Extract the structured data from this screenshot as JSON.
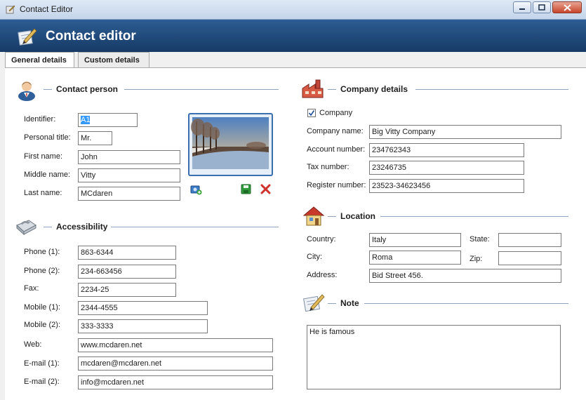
{
  "window": {
    "title": "Contact Editor"
  },
  "header": {
    "title": "Contact editor"
  },
  "tabs": [
    {
      "label": "General details"
    },
    {
      "label": "Custom details"
    }
  ],
  "contact_person": {
    "title": "Contact person",
    "identifier": {
      "label": "Identifier:",
      "value": "A1"
    },
    "personal_title": {
      "label": "Personal title:",
      "value": "Mr."
    },
    "first_name": {
      "label": "First name:",
      "value": "John"
    },
    "middle_name": {
      "label": "Middle name:",
      "value": "Vitty"
    },
    "last_name": {
      "label": "Last name:",
      "value": "MCdaren"
    }
  },
  "accessibility": {
    "title": "Accessibility",
    "phone1": {
      "label": "Phone (1):",
      "value": "863-6344"
    },
    "phone2": {
      "label": "Phone (2):",
      "value": "234-663456"
    },
    "fax": {
      "label": "Fax:",
      "value": "2234-25"
    },
    "mobile1": {
      "label": "Mobile (1):",
      "value": "2344-4555"
    },
    "mobile2": {
      "label": "Mobile (2):",
      "value": "333-3333"
    },
    "web": {
      "label": "Web:",
      "value": "www.mcdaren.net"
    },
    "email1": {
      "label": "E-mail (1):",
      "value": "mcdaren@mcdaren.net"
    },
    "email2": {
      "label": "E-mail (2):",
      "value": "info@mcdaren.net"
    }
  },
  "company_details": {
    "title": "Company details",
    "company_checkbox": {
      "label": "Company",
      "checked": true
    },
    "company_name": {
      "label": "Company name:",
      "value": "Big Vitty Company"
    },
    "account_number": {
      "label": "Account number:",
      "value": "234762343"
    },
    "tax_number": {
      "label": "Tax number:",
      "value": "23246735"
    },
    "register_number": {
      "label": "Register number:",
      "value": "23523-34623456"
    }
  },
  "location": {
    "title": "Location",
    "country": {
      "label": "Country:",
      "value": "Italy"
    },
    "state": {
      "label": "State:",
      "value": ""
    },
    "city": {
      "label": "City:",
      "value": "Roma"
    },
    "zip": {
      "label": "Zip:",
      "value": ""
    },
    "address": {
      "label": "Address:",
      "value": "Bid Street 456."
    }
  },
  "note": {
    "title": "Note",
    "value": "He is famous"
  },
  "photo_actions": {
    "add_icon": "add-photo-icon",
    "save_icon": "save-icon",
    "delete_icon": "delete-icon"
  },
  "colors": {
    "header": "#1f4a7e",
    "accent": "#3a6fb0",
    "section_line": "#8fa3bd"
  }
}
